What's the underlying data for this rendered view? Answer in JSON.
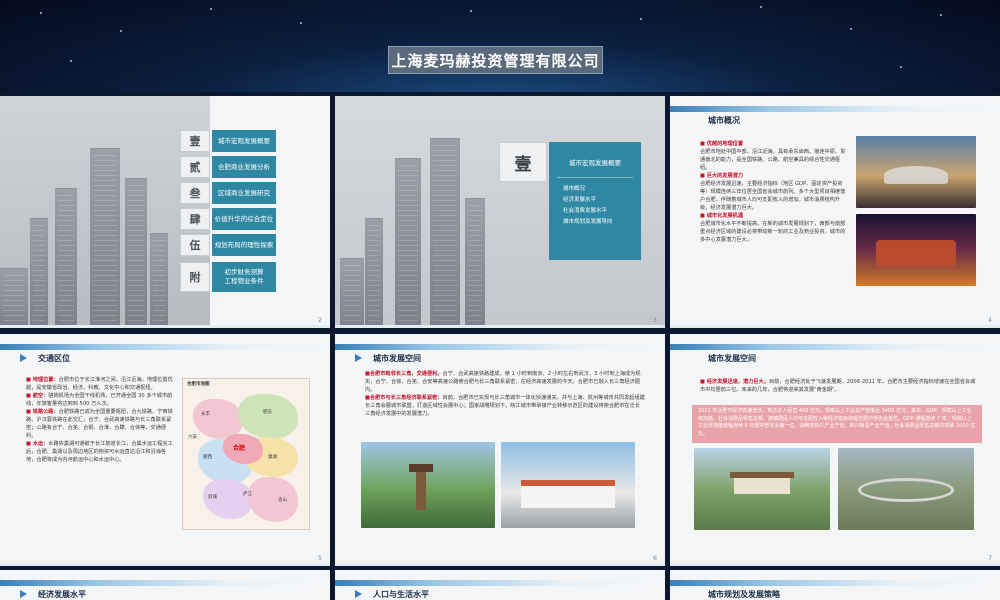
{
  "banner": {
    "title": "上海麦玛赫投资管理有限公司"
  },
  "slide1": {
    "toc": [
      {
        "num": "壹",
        "label": "城市宏观发展概要"
      },
      {
        "num": "贰",
        "label": "合肥商业发展分析"
      },
      {
        "num": "叁",
        "label": "区域商业发展研究"
      },
      {
        "num": "肆",
        "label": "价值升华的综合定位"
      },
      {
        "num": "伍",
        "label": "规划布局的理性探索"
      },
      {
        "num": "附",
        "label": "初步财务测算",
        "label2": "工程物业条件"
      }
    ],
    "page": "2"
  },
  "slide2": {
    "num": "壹",
    "heading": "城市宏观发展概要",
    "items": [
      "城市概况",
      "经济发展水平",
      "社会消费发展水平",
      "城市规划及发展导向"
    ],
    "page": "3"
  },
  "slide3": {
    "title": "城市概况",
    "sections": [
      {
        "head": "优越的地理位置",
        "body": "合肥市地处中国中部、沿江近海，具有承东启西、接连中原、贯通南北的能力，是全国铁路、公路、航空兼具的综合性交通枢纽。"
      },
      {
        "head": "巨大的发展潜力",
        "body": "合肥经济发展迅速，主要经济指标（地区 GDP、固定资产投资等）规模连续三年位居全国省会城市前列。多个大型项目相继落户合肥，伴随着城市人均可支配收入的增加，城市消费结构升级，经济发展潜力巨大。"
      },
      {
        "head": "城市化发展机遇",
        "body": "合肥城市化水平不断提高，在新的城市发展规划下，西部与南部重点经济区域的建设必将带动新一轮的工业及商业投资，城市的多中心发展潜力巨大。"
      }
    ],
    "page": "4"
  },
  "slide4": {
    "title": "交通区位",
    "sections": [
      {
        "head": "地理位置：",
        "body": "合肥市位于长江淮河之间，沿江近海，地理位置优越，是安徽省政治、经济、科教、文化中心和交通枢纽。"
      },
      {
        "head": "航空：",
        "body": "骆岗机场为全国干线机场，已开通全国 30 多个城市航线，年旅客量将达到到 500 万人次。"
      },
      {
        "head": "铁路公路：",
        "body": "合肥铁路已成为全国重要枢纽，合九铁路、宁西铁路、沪汉蓉铁路在此交汇，合宁、合武高速铁路与长三角联系紧密；公路有合宁、合芜、合铜、合淮、合肆、合徐等，交通便利。"
      },
      {
        "head": "水运：",
        "body": "水路依巢湖可通航于长江航道长江，合巢水运工程完工后，合肥、巢湖以及周边地区的物资可水运直达沿江和沿海各地，合肥将成为内河航运中心和水运中心。"
      }
    ],
    "map": {
      "header": "合肥市地图",
      "places": [
        "长丰",
        "肥东",
        "肥西",
        "巢湖",
        "六安",
        "庐江",
        "舒城",
        "含山"
      ],
      "center": "合肥"
    },
    "page": "5"
  },
  "slide5": {
    "title": "城市发展空间",
    "sections": [
      {
        "head": "合肥市毗邻长三角，交通便利。",
        "body": "合宁、合武高速铁路建成，使 1 小时到南京、2 小时左右到武汉、3 小时到上海成为现实，合宁、合徐、合芜、合安等高速公路使合肥与长三角联系紧密，在经济高速发展的今天，合肥市已融入长三角经济圈内。"
      },
      {
        "head": "合肥市与长三角经济联系紧密：",
        "body": "目前，合肥市已实现与长三角城市一体化快速通关，并与上海、杭州等城市共同发起组建长三角会展城市联盟，打造区域性会展中心；国家战略规划下，皖江城市带承接产业转移示范区的建设将使合肥市在泛长三角经济发展中的发展潜力。"
      }
    ],
    "page": "6"
  },
  "slide6": {
    "title": "城市发展空间",
    "sections": [
      {
        "head": "经济发展迅速，潜力巨大，",
        "body": "目前，合肥经济处于飞速发展期，2006-2011 年，合肥市主要经济指标增速在全国省会城市中均居前三位。未来的几年，合肥将迎来其发展\"黄金期\"。"
      }
    ],
    "pinkbox": "2011 年合肥市经济高速增长，到达达人民营 400 亿元，规模以上工业总产值接近 3400 亿元，其中，GDP、规模以上工业增加值、社会消费品零售总额、城镇居民人均可支配收入等经济指标增幅位居中部省会首位。GDP 增幅连续 7 年，规模以上工业增加值增幅连续 8 年居中部省会第一位，战略性新兴产业产值，新兴制造产业产值，社会消费品零售总额均突破 1000 亿元。",
    "page": "7"
  },
  "slide7": {
    "title": "经济发展水平"
  },
  "slide8": {
    "title": "人口与生活水平"
  },
  "slide9": {
    "title": "城市规划及发展策略"
  },
  "colors": {
    "teal": "#2f88a3",
    "red": "#c0152a",
    "blue": "#3a7fb8"
  }
}
